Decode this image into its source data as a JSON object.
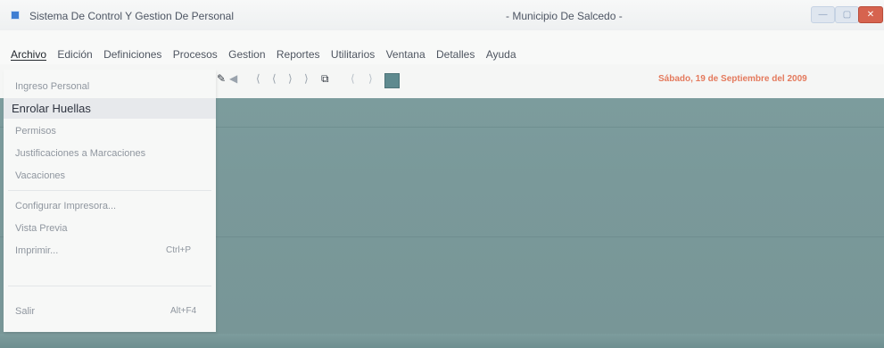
{
  "window": {
    "title": "Sistema De Control Y Gestion De Personal",
    "center_title": "- Municipio De Salcedo -",
    "controls": {
      "minimize": "—",
      "maximize": "▢",
      "close": "✕"
    }
  },
  "menubar": {
    "items": [
      "Archivo",
      "Edición",
      "Definiciones",
      "Procesos",
      "Gestion",
      "Reportes",
      "Utilitarios",
      "Ventana",
      "Detalles",
      "Ayuda"
    ]
  },
  "toolbar": {
    "date": "Sábado, 19 de Septiembre del 2009",
    "icons": {
      "pencil": "✎",
      "speaker": "◀",
      "nav1": "⟨",
      "nav2": "⟨",
      "nav3": "⟩",
      "nav4": "⟩",
      "tree": "⧉",
      "nav5": "⟨",
      "nav6": "⟩"
    }
  },
  "dropdown": {
    "items": [
      {
        "label": "Ingreso Personal",
        "shortcut": ""
      },
      {
        "label": "Enrolar Huellas",
        "shortcut": ""
      },
      {
        "label": "Permisos",
        "shortcut": ""
      },
      {
        "label": "Justificaciones a Marcaciones",
        "shortcut": ""
      },
      {
        "label": "Vacaciones",
        "shortcut": ""
      },
      {
        "label": "Configurar Impresora...",
        "shortcut": ""
      },
      {
        "label": "Vista Previa",
        "shortcut": ""
      },
      {
        "label": "Imprimir...",
        "shortcut": "Ctrl+P"
      },
      {
        "label": "Salir",
        "shortcut": "Alt+F4"
      }
    ],
    "highlighted_index": 1
  },
  "colors": {
    "workspace": "#7a999a",
    "date_text": "#e47a5d",
    "close_button": "#d6634f",
    "highlight": "#e7e9ec"
  }
}
